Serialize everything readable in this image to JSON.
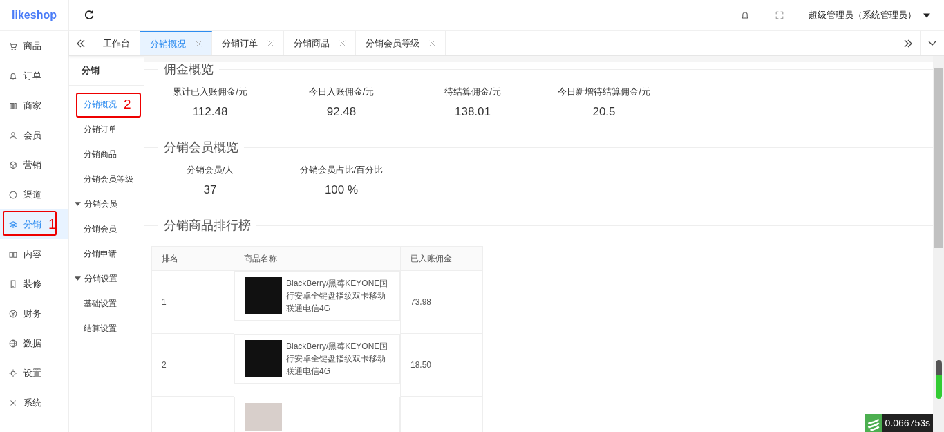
{
  "logo": "likeshop",
  "header": {
    "user": "超级管理员（系统管理员）"
  },
  "sidebar": {
    "items": [
      {
        "label": "商品",
        "selected": false
      },
      {
        "label": "订单",
        "selected": false
      },
      {
        "label": "商家",
        "selected": false
      },
      {
        "label": "会员",
        "selected": false
      },
      {
        "label": "营销",
        "selected": false
      },
      {
        "label": "渠道",
        "selected": false
      },
      {
        "label": "分销",
        "selected": true,
        "annotation": "1"
      },
      {
        "label": "内容",
        "selected": false
      },
      {
        "label": "装修",
        "selected": false
      },
      {
        "label": "财务",
        "selected": false
      },
      {
        "label": "数据",
        "selected": false
      },
      {
        "label": "设置",
        "selected": false
      },
      {
        "label": "系统",
        "selected": false
      }
    ]
  },
  "tabs": [
    {
      "label": "工作台",
      "selected": false,
      "closable": false
    },
    {
      "label": "分销概况",
      "selected": true,
      "closable": true
    },
    {
      "label": "分销订单",
      "selected": false,
      "closable": true
    },
    {
      "label": "分销商品",
      "selected": false,
      "closable": true
    },
    {
      "label": "分销会员等级",
      "selected": false,
      "closable": true
    }
  ],
  "submenu": {
    "title": "分销",
    "items": [
      {
        "kind": "link",
        "label": "分销概况",
        "selected": true,
        "annotation": "2"
      },
      {
        "kind": "link",
        "label": "分销订单",
        "selected": false
      },
      {
        "kind": "link",
        "label": "分销商品",
        "selected": false
      },
      {
        "kind": "link",
        "label": "分销会员等级",
        "selected": false
      },
      {
        "kind": "group",
        "label": "分销会员",
        "expanded": true
      },
      {
        "kind": "link",
        "label": "分销会员",
        "selected": false
      },
      {
        "kind": "link",
        "label": "分销申请",
        "selected": false
      },
      {
        "kind": "group",
        "label": "分销设置",
        "expanded": true
      },
      {
        "kind": "link",
        "label": "基础设置",
        "selected": false
      },
      {
        "kind": "link",
        "label": "结算设置",
        "selected": false
      }
    ]
  },
  "sections": [
    {
      "title": "佣金概览",
      "stats": [
        {
          "label": "累计已入账佣金/元",
          "value": "112.48"
        },
        {
          "label": "今日入账佣金/元",
          "value": "92.48"
        },
        {
          "label": "待结算佣金/元",
          "value": "138.01"
        },
        {
          "label": "今日新增待结算佣金/元",
          "value": "20.5"
        }
      ]
    },
    {
      "title": "分销会员概览",
      "stats": [
        {
          "label": "分销会员/人",
          "value": "37"
        },
        {
          "label": "分销会员占比/百分比",
          "value": "100 %"
        }
      ]
    },
    {
      "title": "分销商品排行榜",
      "table": {
        "columns": [
          "排名",
          "商品名称",
          "已入账佣金"
        ],
        "rows": [
          {
            "rank": "1",
            "name": "BlackBerry/黑莓KEYONE国行安卓全键盘指纹双卡移动联通电信4G",
            "amount": "73.98"
          },
          {
            "rank": "2",
            "name": "BlackBerry/黑莓KEYONE国行安卓全键盘指纹双卡移动联通电信4G",
            "amount": "18.50"
          }
        ],
        "partial_row_below": true
      }
    }
  ],
  "debug_badge": {
    "time": "0.066753s"
  }
}
